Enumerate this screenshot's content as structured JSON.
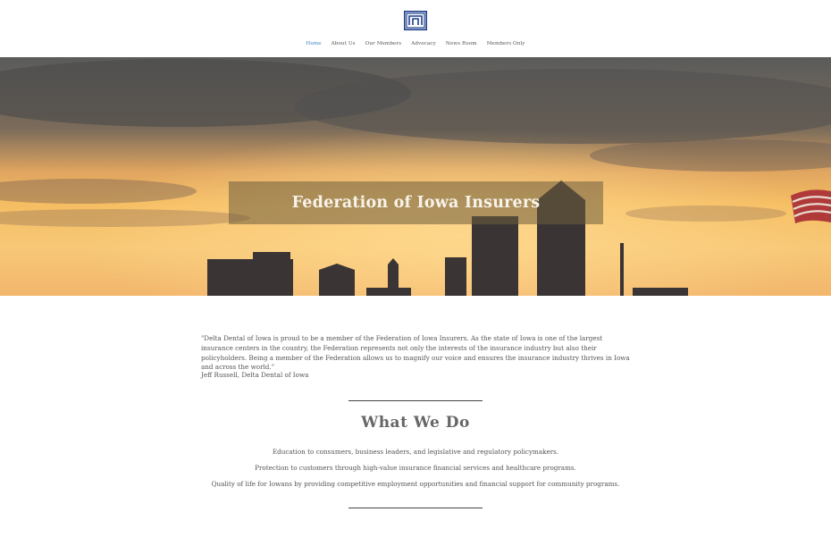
{
  "nav": {
    "items": [
      {
        "label": "Home",
        "active": true
      },
      {
        "label": "About Us",
        "active": false
      },
      {
        "label": "Our Members",
        "active": false
      },
      {
        "label": "Advocacy",
        "active": false
      },
      {
        "label": "News Room",
        "active": false
      },
      {
        "label": "Members Only",
        "active": false
      }
    ]
  },
  "logo": {
    "icon": "fii-logo-icon",
    "color": "#1f3f8a"
  },
  "hero": {
    "title": "Federation of Iowa Insurers",
    "image": "city skyline at sunset"
  },
  "testimonial": {
    "quote": "\"Delta Dental of Iowa is proud to be a member of the Federation of Iowa Insurers. As the state of Iowa is one of the largest insurance centers in the country, the Federation represents not only the interests of the insurance industry but also their policyholders. Being a member of the Federation allows us to magnify our voice and ensures the insurance industry thrives in Iowa and across the world.\"",
    "author": "Jeff Russell, Delta Dental of Iowa"
  },
  "what_we_do": {
    "title": "What We Do",
    "items": [
      "Education to consumers, business leaders, and legislative and regulatory policymakers.",
      "Protection to customers through high-value insurance financial services and healthcare programs.",
      "Quality of life for Iowans by providing competitive employment opportunities and financial support for community programs."
    ]
  },
  "colors": {
    "accent": "#3b7fc4",
    "text": "#555555"
  }
}
